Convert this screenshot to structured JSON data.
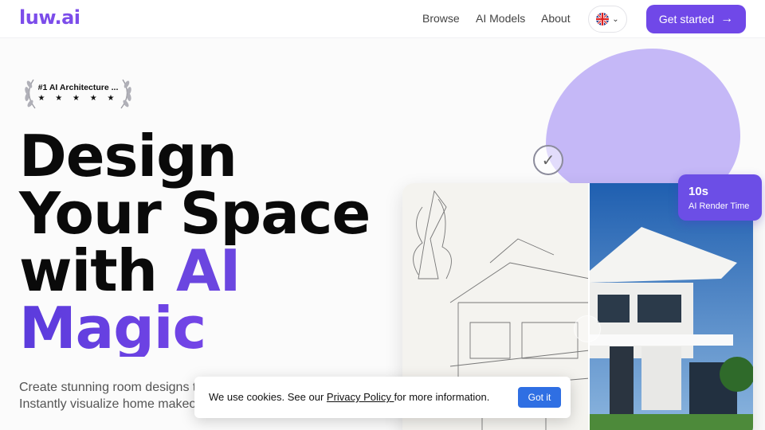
{
  "header": {
    "logo": "luw.ai",
    "nav": [
      "Browse",
      "AI Models",
      "About"
    ],
    "language_flag": "uk-flag-icon",
    "cta_label": "Get started",
    "cta_icon": "arrow-right-icon"
  },
  "badge": {
    "title": "#1 AI Architecture ...",
    "stars": "★ ★ ★ ★ ★",
    "rating": 5
  },
  "hero": {
    "line1": "Design",
    "line2": "Your Space",
    "line3a": "with ",
    "line3b": "AI",
    "line4": "Magic",
    "description": "Create stunning room designs transformations in seconds w Instantly visualize home makeovers, interior renovations,"
  },
  "stat": {
    "value": "10s",
    "label": "AI Render Time"
  },
  "cookie": {
    "text_before": "We use cookies. See our ",
    "link": "Privacy Policy ",
    "text_after": "for more information.",
    "button": "Got it"
  },
  "colors": {
    "brand": "#7048e8",
    "blob": "#c5b8f7",
    "cookie_button": "#2f6fe3"
  }
}
